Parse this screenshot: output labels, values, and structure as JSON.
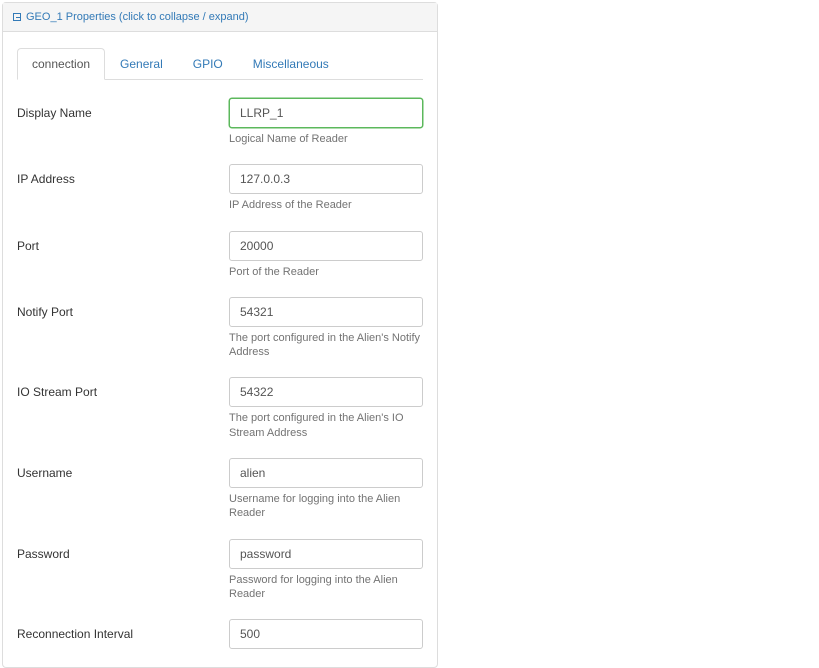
{
  "panel": {
    "title": "GEO_1 Properties (click to collapse / expand)"
  },
  "tabs": [
    "connection",
    "General",
    "GPIO",
    "Miscellaneous"
  ],
  "activeTab": 0,
  "fields": {
    "displayName": {
      "label": "Display Name",
      "value": "LLRP_1",
      "help": "Logical Name of Reader",
      "highlight": true
    },
    "ipAddress": {
      "label": "IP Address",
      "value": "127.0.0.3",
      "help": "IP Address of the Reader"
    },
    "port": {
      "label": "Port",
      "value": "20000",
      "help": "Port of the Reader"
    },
    "notifyPort": {
      "label": "Notify Port",
      "value": "54321",
      "help": "The port configured in the Alien's Notify Address"
    },
    "ioStreamPort": {
      "label": "IO Stream Port",
      "value": "54322",
      "help": "The port configured in the Alien's IO Stream Address"
    },
    "username": {
      "label": "Username",
      "value": "alien",
      "help": "Username for logging into the Alien Reader"
    },
    "password": {
      "label": "Password",
      "value": "password",
      "help": "Password for logging into the Alien Reader"
    },
    "reconnectionInterval": {
      "label": "Reconnection Interval",
      "value": "500",
      "help": ""
    }
  }
}
